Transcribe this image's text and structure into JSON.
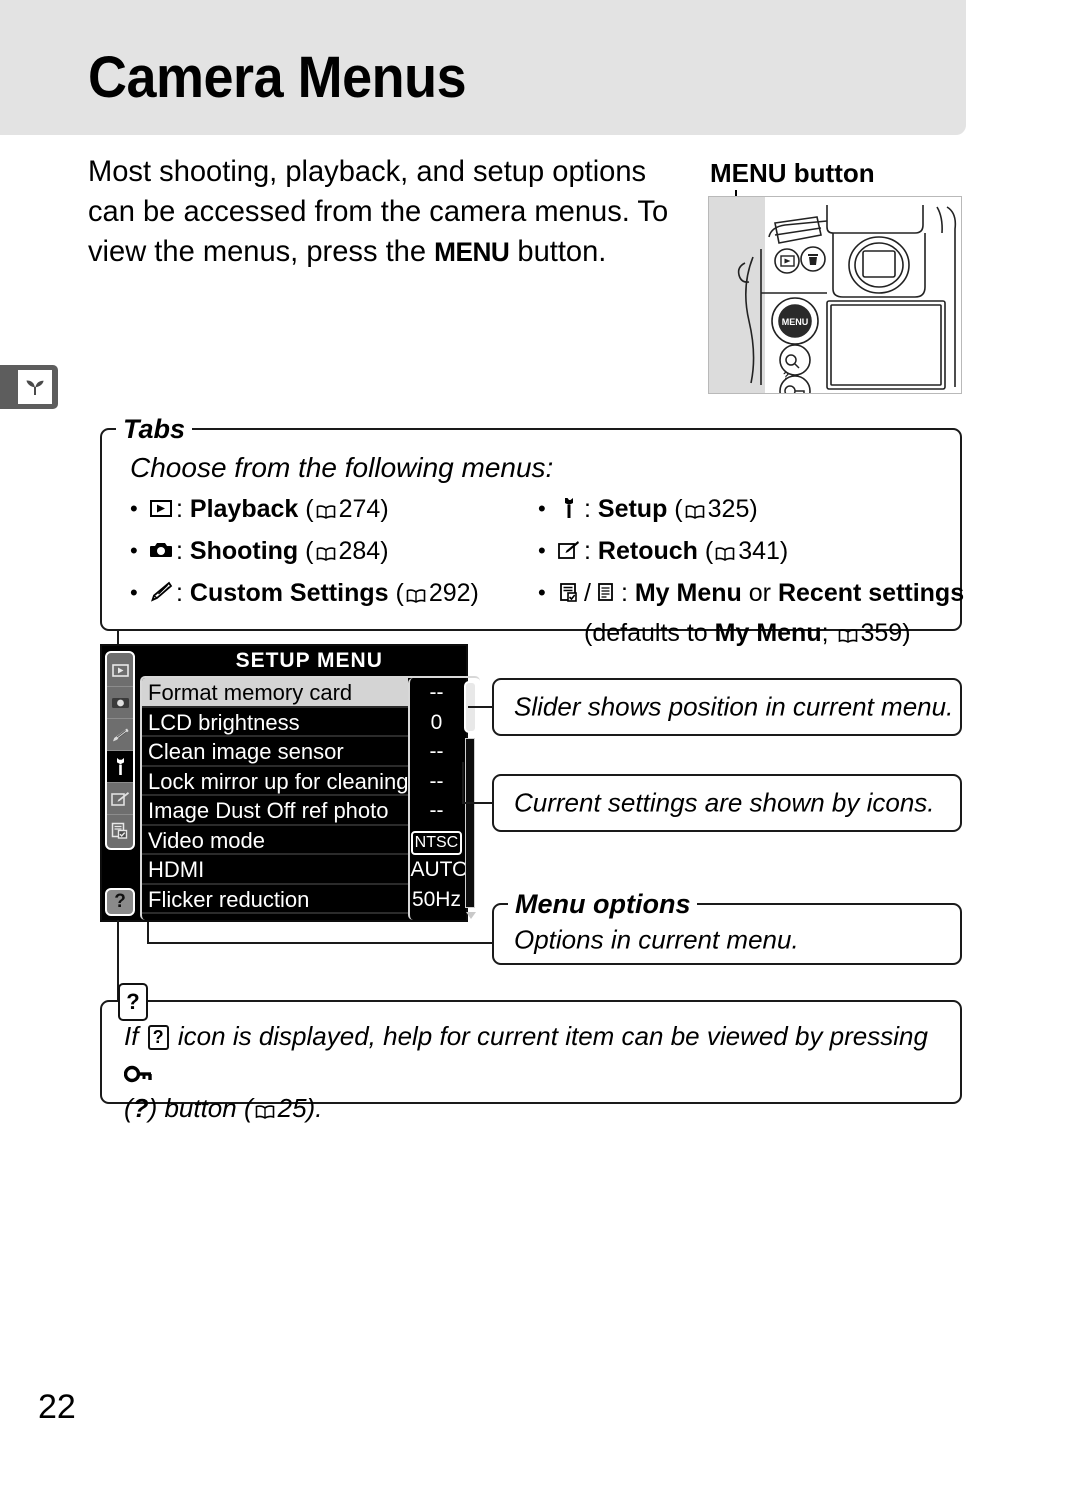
{
  "page": {
    "title": "Camera Menus",
    "number": "22",
    "side_tab_icon": "seedling-icon"
  },
  "intro": {
    "line1": "Most shooting, playback, and setup options",
    "line2": "can be accessed from the camera menus.  To",
    "line3_before": "view the menus, press the ",
    "line3_button": "MENU",
    "line3_after": " button."
  },
  "figure": {
    "label": "MENU button",
    "label_bold_word": "MENU",
    "label_rest": " button",
    "button_text": "MENU"
  },
  "tabs_box": {
    "title": "Tabs",
    "lead": "Choose from the following menus:",
    "left_items": [
      {
        "icon": "playback-icon",
        "label": "Playback",
        "ref": "274"
      },
      {
        "icon": "camera-icon",
        "label": "Shooting",
        "ref": "284"
      },
      {
        "icon": "pencil-icon",
        "label": "Custom Settings",
        "ref": "292"
      }
    ],
    "right_items": [
      {
        "icon": "wrench-icon",
        "label": "Setup",
        "ref": "325"
      },
      {
        "icon": "retouch-icon",
        "label": "Retouch",
        "ref": "341"
      },
      {
        "icon": "mymenu-icon",
        "label": "My Menu",
        "label2": "Recent settings",
        "joiner": "or",
        "ref": ""
      }
    ],
    "right_subnote_pre": "(defaults to ",
    "right_subnote_bold": "My Menu",
    "right_subnote_mid": "; ",
    "right_subnote_ref": "359",
    "right_subnote_post": ")"
  },
  "lcd": {
    "header": "SETUP MENU",
    "tab_icons": [
      "playback-icon",
      "shooting-icon",
      "custom-settings-icon",
      "setup-icon",
      "retouch-icon",
      "my-menu-icon"
    ],
    "selected_tab_index": 3,
    "help_tab_label": "?",
    "rows": [
      {
        "label": "Format memory card",
        "value": "--",
        "highlighted": true,
        "boxed": false
      },
      {
        "label": "LCD brightness",
        "value": "0",
        "highlighted": false,
        "boxed": false
      },
      {
        "label": "Clean image sensor",
        "value": "--",
        "highlighted": false,
        "boxed": false
      },
      {
        "label": "Lock mirror up for cleaning",
        "value": "--",
        "highlighted": false,
        "boxed": false
      },
      {
        "label": "Image Dust Off ref photo",
        "value": "--",
        "highlighted": false,
        "boxed": false
      },
      {
        "label": "Video mode",
        "value": "NTSC",
        "highlighted": false,
        "boxed": true
      },
      {
        "label": "HDMI",
        "value": "AUTO",
        "highlighted": false,
        "boxed": false
      },
      {
        "label": "Flicker reduction",
        "value": "50Hz",
        "highlighted": false,
        "boxed": false
      }
    ]
  },
  "callouts": {
    "slider": "Slider shows position in current menu.",
    "icons": "Current settings are shown by icons.",
    "menu_options_title": "Menu options",
    "menu_options_text": "Options in current menu."
  },
  "help_box": {
    "badge": "?",
    "text_pre": "If ",
    "chip": "?",
    "text_mid": " icon is displayed, help for current item can be viewed by pressing ",
    "key_icon": "key-protect-icon",
    "text_line2_pre": "(",
    "text_line2_q": "?",
    "text_line2_mid": ") button (",
    "text_line2_ref": "25",
    "text_line2_post": ")."
  },
  "colors": {
    "header_band": "#e3e3e3",
    "side_tab": "#5d5d5d",
    "lcd_background": "#000000",
    "lcd_highlight": "#d4d4d4",
    "ink": "#1a1a1a"
  }
}
